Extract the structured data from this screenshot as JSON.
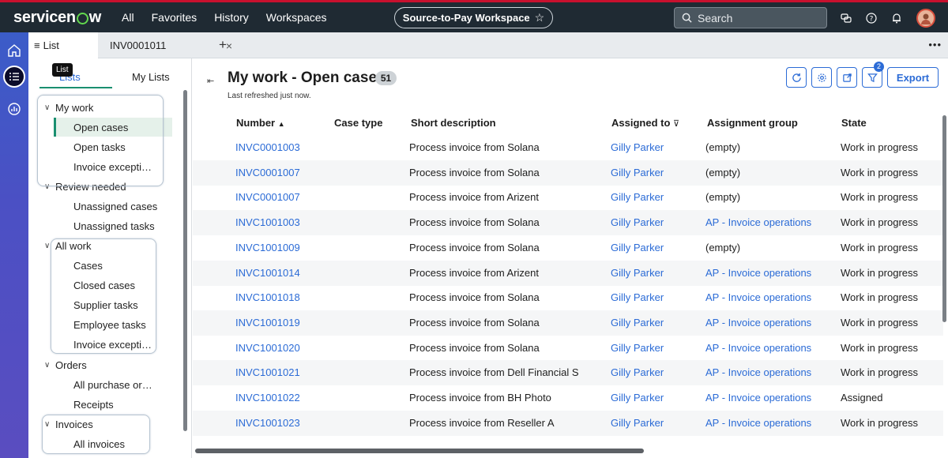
{
  "topnav": {
    "logo": "servicenow",
    "links": [
      "All",
      "Favorites",
      "History",
      "Workspaces"
    ],
    "workspace": "Source-to-Pay Workspace",
    "search_placeholder": "Search"
  },
  "tabs": {
    "list_label": "List",
    "record_label": "INV0001011"
  },
  "tooltip": "List",
  "panel": {
    "tab_lists": "Lists",
    "tab_mylists": "My Lists",
    "groups": [
      {
        "label": "My work",
        "items": [
          "Open cases",
          "Open tasks",
          "Invoice excepti…"
        ]
      },
      {
        "label": "Review needed",
        "items": [
          "Unassigned cases",
          "Unassigned tasks"
        ]
      },
      {
        "label": "All work",
        "items": [
          "Cases",
          "Closed cases",
          "Supplier tasks",
          "Employee tasks",
          "Invoice excepti…"
        ]
      },
      {
        "label": "Orders",
        "items": [
          "All purchase or…",
          "Receipts"
        ]
      },
      {
        "label": "Invoices",
        "items": [
          "All invoices"
        ]
      }
    ]
  },
  "main": {
    "title": "My work - Open cases",
    "count": "51",
    "refreshed": "Last refreshed just now.",
    "filter_count": "2",
    "export_label": "Export",
    "columns": [
      "Number",
      "Case type",
      "Short description",
      "Assigned to",
      "Assignment group",
      "State"
    ],
    "rows": [
      {
        "number": "INVC0001003",
        "case_type": "",
        "desc": "Process invoice from Solana",
        "assigned": "Gilly Parker",
        "group": "(empty)",
        "state": "Work in progress"
      },
      {
        "number": "INVC0001007",
        "case_type": "",
        "desc": "Process invoice from Solana",
        "assigned": "Gilly Parker",
        "group": "(empty)",
        "state": "Work in progress"
      },
      {
        "number": "INVC0001007",
        "case_type": "",
        "desc": "Process invoice from Arizent",
        "assigned": "Gilly Parker",
        "group": "(empty)",
        "state": "Work in progress"
      },
      {
        "number": "INVC1001003",
        "case_type": "",
        "desc": "Process invoice from Solana",
        "assigned": "Gilly Parker",
        "group": "AP - Invoice operations",
        "state": "Work in progress"
      },
      {
        "number": "INVC1001009",
        "case_type": "",
        "desc": "Process invoice from Solana",
        "assigned": "Gilly Parker",
        "group": "(empty)",
        "state": "Work in progress"
      },
      {
        "number": "INVC1001014",
        "case_type": "",
        "desc": "Process invoice from Arizent",
        "assigned": "Gilly Parker",
        "group": "AP - Invoice operations",
        "state": "Work in progress"
      },
      {
        "number": "INVC1001018",
        "case_type": "",
        "desc": "Process invoice from Solana",
        "assigned": "Gilly Parker",
        "group": "AP - Invoice operations",
        "state": "Work in progress"
      },
      {
        "number": "INVC1001019",
        "case_type": "",
        "desc": "Process invoice from Solana",
        "assigned": "Gilly Parker",
        "group": "AP - Invoice operations",
        "state": "Work in progress"
      },
      {
        "number": "INVC1001020",
        "case_type": "",
        "desc": "Process invoice from Solana",
        "assigned": "Gilly Parker",
        "group": "AP - Invoice operations",
        "state": "Work in progress"
      },
      {
        "number": "INVC1001021",
        "case_type": "",
        "desc": "Process invoice from Dell Financial Ser",
        "assigned": "Gilly Parker",
        "group": "AP - Invoice operations",
        "state": "Work in progress"
      },
      {
        "number": "INVC1001022",
        "case_type": "",
        "desc": "Process invoice from BH Photo",
        "assigned": "Gilly Parker",
        "group": "AP - Invoice operations",
        "state": "Assigned"
      },
      {
        "number": "INVC1001023",
        "case_type": "",
        "desc": "Process invoice from Reseller A",
        "assigned": "Gilly Parker",
        "group": "AP - Invoice operations",
        "state": "Work in progress"
      }
    ]
  },
  "colors": {
    "link": "#2b6bd6",
    "accent": "#1a8f70",
    "nav_bg": "#1f2a33",
    "brand_red": "#c8102e"
  }
}
